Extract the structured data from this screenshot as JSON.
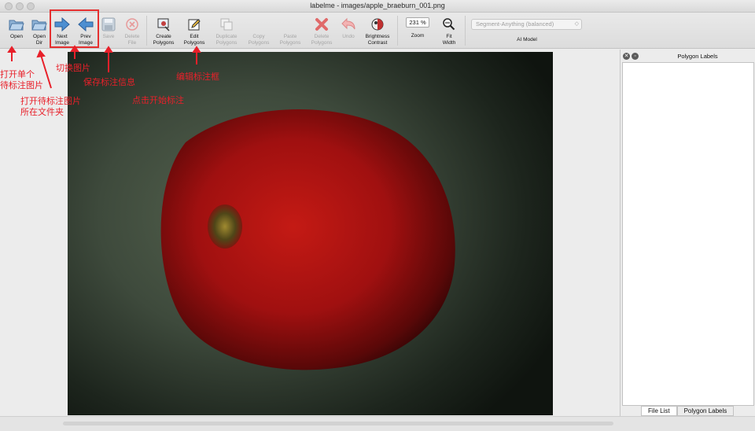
{
  "window": {
    "title": "labelme - images/apple_braeburn_001.png"
  },
  "toolbar": {
    "open": "Open",
    "open_dir": "Open\nDir",
    "next_image": "Next\nImage",
    "prev_image": "Prev\nImage",
    "save": "Save",
    "delete_file": "Delete\nFile",
    "create_polygons": "Create\nPolygons",
    "edit_polygons": "Edit\nPolygons",
    "duplicate_polygons": "Duplicate\nPolygons",
    "copy_polygons": "Copy\nPolygons",
    "paste_polygons": "Paste\nPolygons",
    "delete_polygons": "Delete\nPolygons",
    "undo": "Undo",
    "brightness_contrast": "Brightness\nContrast",
    "zoom_value": "231 %",
    "zoom_label": "Zoom",
    "fit_width": "Fit\nWidth",
    "ai_model_value": "Segment-Anything (balanced)",
    "ai_model_label": "AI Model"
  },
  "dock": {
    "title": "Polygon Labels",
    "tabs": [
      "File List",
      "Polygon Labels"
    ],
    "active_tab": "File List"
  },
  "annotations": {
    "open_single": "打开单个\n待标注图片",
    "open_dir": "打开待标注图片\n所在文件夹",
    "switch_image": "切换图片",
    "save_info": "保存标注信息",
    "click_start": "点击开始标注",
    "edit_box": "编辑标注框"
  },
  "colors": {
    "annotation": "#e8202a",
    "photo_bg": "#3e4a3c",
    "apple": "#b01212"
  }
}
